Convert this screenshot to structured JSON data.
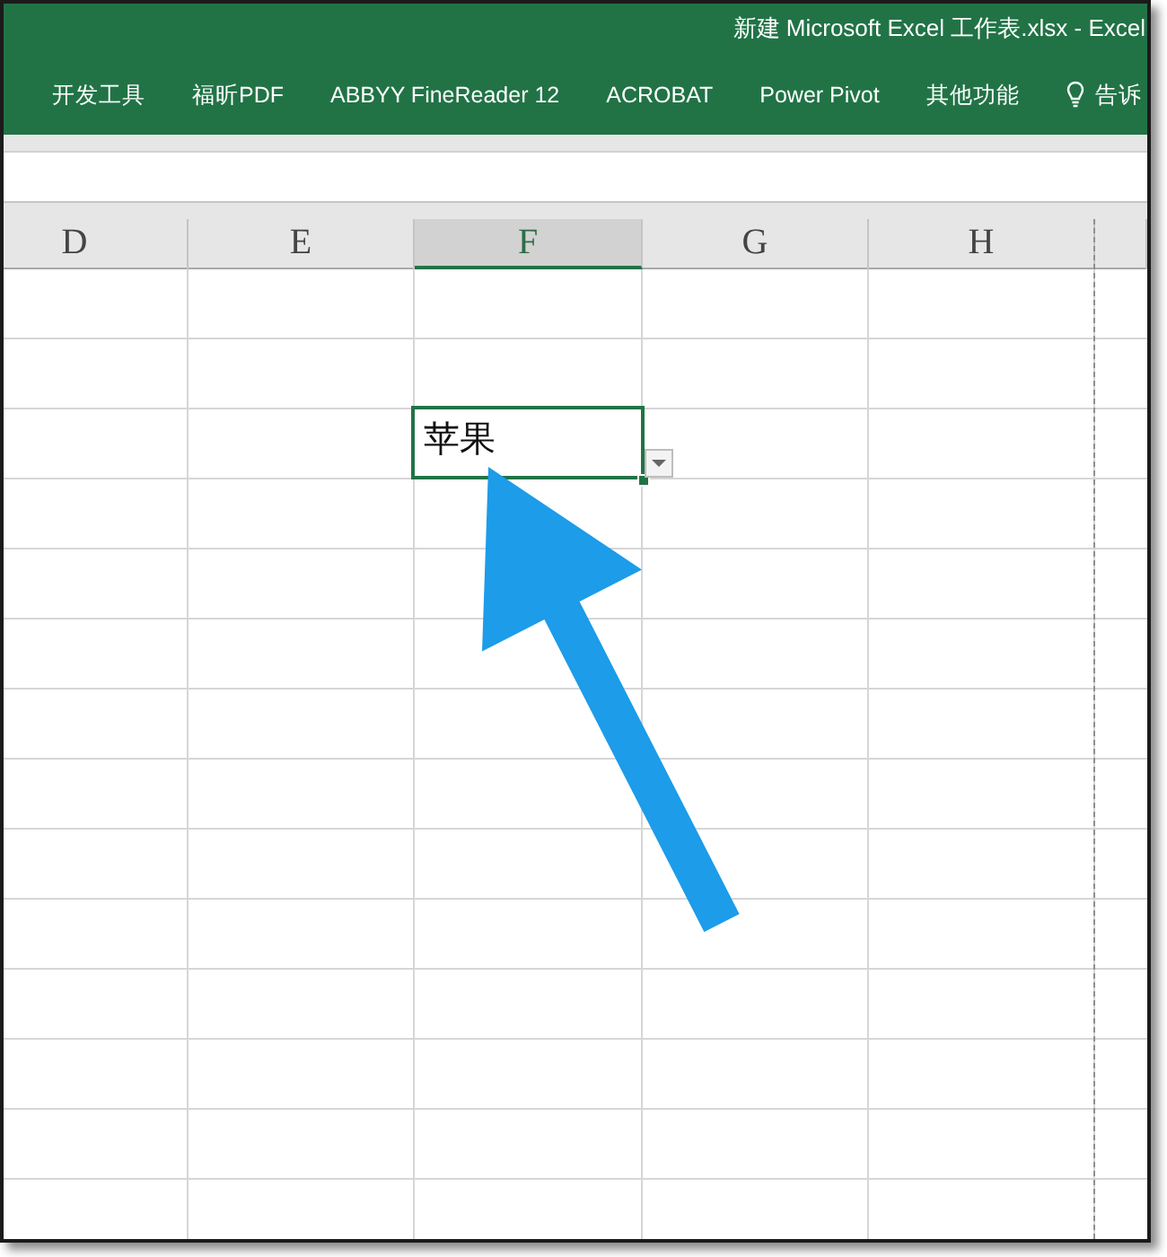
{
  "window": {
    "title": "新建 Microsoft Excel 工作表.xlsx - Excel"
  },
  "ribbon": {
    "tabs": [
      {
        "label": "开发工具",
        "selected": false
      },
      {
        "label": "福昕PDF",
        "selected": false
      },
      {
        "label": "ABBYY FineReader 12",
        "selected": false
      },
      {
        "label": "ACROBAT",
        "selected": false
      },
      {
        "label": "Power Pivot",
        "selected": false
      },
      {
        "label": "其他功能",
        "selected": false
      }
    ],
    "tell_me": {
      "label": "告诉"
    }
  },
  "sheet": {
    "columns": [
      {
        "label": "D",
        "selected": false,
        "page_break": false
      },
      {
        "label": "E",
        "selected": false,
        "page_break": false
      },
      {
        "label": "F",
        "selected": true,
        "page_break": false
      },
      {
        "label": "G",
        "selected": false,
        "page_break": false
      },
      {
        "label": "H",
        "selected": false,
        "page_break": true
      }
    ],
    "rows": [
      {
        "selected": false
      },
      {
        "selected": false
      },
      {
        "selected": true
      },
      {
        "selected": false
      },
      {
        "selected": false
      },
      {
        "selected": false
      },
      {
        "selected": false
      },
      {
        "selected": false
      },
      {
        "selected": false
      },
      {
        "selected": false
      },
      {
        "selected": false
      },
      {
        "selected": false
      },
      {
        "selected": false
      },
      {
        "selected": false
      }
    ],
    "active_cell": {
      "value": "苹果",
      "dropdown": true
    }
  },
  "annotation": {
    "kind": "arrow"
  }
}
